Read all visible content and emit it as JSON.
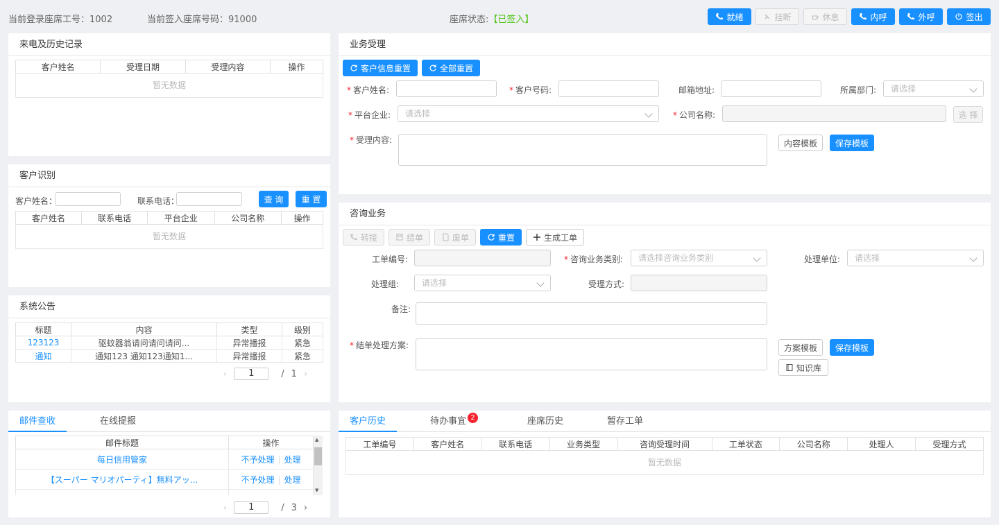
{
  "topbar": {
    "login_label": "当前登录座席工号：1002",
    "seat_label": "当前签入座席号码：91000",
    "status_label": "座席状态:",
    "status_value": "【已签入】",
    "buttons": {
      "ready": "就绪",
      "hangup": "挂断",
      "rest": "休息",
      "inner": "内呼",
      "outer": "外呼",
      "signout": "签出"
    }
  },
  "history": {
    "title": "来电及历史记录",
    "columns": [
      "客户姓名",
      "受理日期",
      "受理内容",
      "操作"
    ],
    "empty": "暂无数据"
  },
  "identify": {
    "title": "客户识别",
    "name_label": "客户姓名：",
    "phone_label": "联系电话：",
    "query": "查 询",
    "reset": "重 置",
    "columns": [
      "客户姓名",
      "联系电话",
      "平台企业",
      "公司名称",
      "操作"
    ],
    "empty": "暂无数据"
  },
  "notice": {
    "title": "系统公告",
    "columns": [
      "标题",
      "内容",
      "类型",
      "级别"
    ],
    "rows": [
      {
        "title": "123123",
        "content": "驱蚊器翁请问请问请问...",
        "type": "异常播报",
        "level": "紧急"
      },
      {
        "title": "通知",
        "content": "通知123 通知123通知1...",
        "type": "异常播报",
        "level": "紧急"
      }
    ],
    "page": "1",
    "sep": "/",
    "total": "1"
  },
  "mail": {
    "tabs": [
      "邮件查收",
      "在线提报"
    ],
    "columns": [
      "邮件标题",
      "操作"
    ],
    "rows": [
      {
        "title": "每日信用管家",
        "ignore": "不予处理",
        "handle": "处理"
      },
      {
        "title": "【スーパー マリオパーティ】無料アッ...",
        "ignore": "不予处理",
        "handle": "处理"
      }
    ],
    "page": "1",
    "sep": "/",
    "total": "3"
  },
  "business": {
    "title": "业务受理",
    "reset_customer": "客户信息重置",
    "reset_all": "全部重置",
    "name_label": "客户姓名:",
    "number_label": "客户号码:",
    "email_label": "邮箱地址:",
    "dept_label": "所属部门:",
    "dept_placeholder": "请选择",
    "platform_label": "平台企业:",
    "platform_placeholder": "请选择",
    "company_label": "公司名称:",
    "select_btn": "选 择",
    "content_label": "受理内容:",
    "content_template": "内容模板",
    "save_template": "保存模板"
  },
  "consult": {
    "title": "咨询业务",
    "transfer": "转接",
    "close": "结单",
    "void": "废单",
    "reset": "重置",
    "create": "生成工单",
    "order_no_label": "工单编号:",
    "type_label": "咨询业务类别:",
    "type_placeholder": "请选择咨询业务类别",
    "unit_label": "处理单位:",
    "unit_placeholder": "请选择",
    "group_label": "处理组:",
    "group_placeholder": "请选择",
    "method_label": "受理方式:",
    "remark_label": "备注:",
    "plan_label": "结单处理方案:",
    "plan_template": "方案模板",
    "save_template": "保存模板",
    "knowledge": "知识库"
  },
  "bottom": {
    "tabs": [
      "客户历史",
      "待办事宜",
      "座席历史",
      "暂存工单"
    ],
    "badge": "2",
    "columns": [
      "工单编号",
      "客户姓名",
      "联系电话",
      "业务类型",
      "咨询受理时间",
      "工单状态",
      "公司名称",
      "处理人",
      "受理方式"
    ],
    "empty": "暂无数据"
  },
  "colors": {
    "primary": "#1890ff",
    "success": "#52c41a",
    "danger": "#f5222d"
  }
}
